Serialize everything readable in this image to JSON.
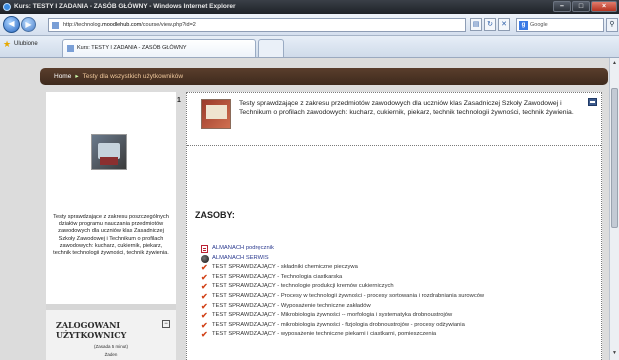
{
  "window": {
    "title": "Kurs: TESTY I ZADANIA - ZASÓB GŁÓWNY - Windows Internet Explorer",
    "controls": {
      "minimize": "–",
      "maximize": "□",
      "close": "×"
    }
  },
  "address_bar": {
    "url_prefix": "http://technolog.",
    "url_domain": "moodlehub.com",
    "url_path": "/course/view.php?id=2",
    "search_placeholder": "Google"
  },
  "favorites": {
    "label": "Ulubione"
  },
  "tab": {
    "title": "Kurs: TESTY I ZADANIA - ZASÓB GŁÓWNY"
  },
  "breadcrumb": {
    "home": "Home",
    "separator": "▸",
    "current": "Testy dla wszystkich użytkowników"
  },
  "left_block": {
    "description": "Testy sprawdzające z zakresu poszczególnych działów programu nauczania przedmiotów zawodowych dla uczniów klas Zasadniczej Szkoły Zawodowej i Technikum o profilach zawodowych: kucharz, cukiernik, piekarz, technik technologii żywności, technik żywienia."
  },
  "online_users": {
    "title": "ZALOGOWANI UŻYTKOWNICY",
    "toggle": "−",
    "period": "(Zasada 5 minut)",
    "none": "Żaden"
  },
  "topic": {
    "number": "1",
    "summary": "Testy sprawdzające z zakresu przedmiotów zawodowych dla uczniów klas Zasadniczej Szkoły Zawodowej i Technikum o profilach zawodowych: kucharz, cukiernik, piekarz, technik technologii żywności, technik żywienia."
  },
  "resources": {
    "heading": "ZASOBY:",
    "items": [
      {
        "icon": "pdf-icon",
        "label": "ALMANACH podręcznik"
      },
      {
        "icon": "web-icon",
        "label": "ALMANACH SERWIS"
      },
      {
        "icon": "checkmark-icon",
        "label": "TEST SPRAWDZAJĄCY - składniki chemiczne pieczywa"
      },
      {
        "icon": "checkmark-icon",
        "label": "TEST SPRAWDZAJĄCY - Technologia ciastkarska"
      },
      {
        "icon": "checkmark-icon",
        "label": "TEST SPRAWDZAJĄCY - technologie produkcji kremów cukierniczych"
      },
      {
        "icon": "checkmark-icon",
        "label": "TEST SPRAWDZAJĄCY - Procesy w technologii żywności - procesy sortowania i rozdrabniania surowców"
      },
      {
        "icon": "checkmark-icon",
        "label": "TEST SPRAWDZAJĄCY - Wyposażenie techniczne zakładów"
      },
      {
        "icon": "checkmark-icon",
        "label": "TEST SPRAWDZAJĄCY - Mikrobiologia żywności -- morfologia i systematyka drobnoustrojów"
      },
      {
        "icon": "checkmark-icon",
        "label": "TEST SPRAWDZAJĄCY - mikrobiologia żywności - fizjologia drobnoustrojów - procesy odżywiania"
      },
      {
        "icon": "checkmark-icon",
        "label": "TEST SPRAWDZAJĄCY - wyposażenie techniczne piekarni i ciastkarni, pomieszczenia"
      }
    ]
  }
}
